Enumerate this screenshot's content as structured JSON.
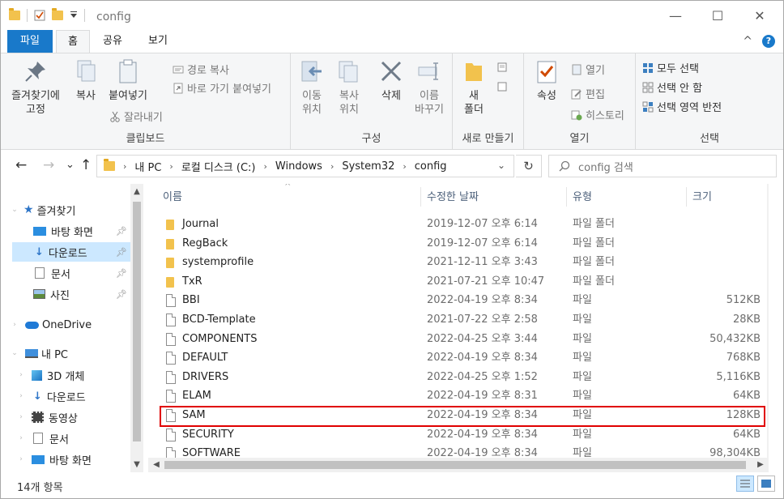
{
  "window": {
    "title": "config",
    "minimize_glyph": "—",
    "maximize_glyph": "☐",
    "close_glyph": "✕"
  },
  "menu": {
    "file": "파일",
    "home": "홈",
    "share": "공유",
    "view": "보기",
    "collapse_glyph": "^",
    "help_glyph": "?"
  },
  "ribbon": {
    "clipboard": {
      "label": "클립보드",
      "pin": "즐겨찾기에\n고정",
      "copy": "복사",
      "paste": "붙여넣기",
      "copy_path": "경로 복사",
      "paste_shortcut": "바로 가기 붙여넣기",
      "cut": "잘라내기"
    },
    "organize": {
      "label": "구성",
      "move_to": "이동\n위치",
      "copy_to": "복사\n위치",
      "delete": "삭제",
      "rename": "이름\n바꾸기"
    },
    "new": {
      "label": "새로 만들기",
      "new_folder": "새\n폴더"
    },
    "open": {
      "label": "열기",
      "properties": "속성",
      "open": "열기",
      "edit": "편집",
      "history": "히스토리"
    },
    "select": {
      "label": "선택",
      "select_all": "모두 선택",
      "select_none": "선택 안 함",
      "invert": "선택 영역 반전"
    }
  },
  "address": {
    "back_glyph": "←",
    "forward_glyph": "→",
    "recent_glyph": "⌄",
    "up_glyph": "↑",
    "crumbs": [
      "내 PC",
      "로컬 디스크 (C:)",
      "Windows",
      "System32",
      "config"
    ],
    "refresh_glyph": "↻",
    "search_placeholder": "config 검색"
  },
  "sidebar": {
    "items": [
      {
        "label": "즐겨찾기",
        "icon": "star-icon"
      },
      {
        "label": "바탕 화면",
        "icon": "desktop-icon"
      },
      {
        "label": "다운로드",
        "icon": "download-icon"
      },
      {
        "label": "문서",
        "icon": "document-icon"
      },
      {
        "label": "사진",
        "icon": "picture-icon"
      },
      {
        "label": "OneDrive",
        "icon": "cloud-icon"
      },
      {
        "label": "내 PC",
        "icon": "computer-icon"
      },
      {
        "label": "3D 개체",
        "icon": "cube-icon"
      },
      {
        "label": "다운로드",
        "icon": "download-icon"
      },
      {
        "label": "동영상",
        "icon": "video-icon"
      },
      {
        "label": "문서",
        "icon": "document-icon"
      },
      {
        "label": "바탕 화면",
        "icon": "desktop-icon"
      }
    ]
  },
  "columns": {
    "name": "이름",
    "date": "수정한 날짜",
    "type": "유형",
    "size": "크기"
  },
  "files": [
    {
      "name": "Journal",
      "date": "2019-12-07 오후 6:14",
      "type": "파일 폴더",
      "size": "",
      "kind": "folder"
    },
    {
      "name": "RegBack",
      "date": "2019-12-07 오후 6:14",
      "type": "파일 폴더",
      "size": "",
      "kind": "folder"
    },
    {
      "name": "systemprofile",
      "date": "2021-12-11 오후 3:43",
      "type": "파일 폴더",
      "size": "",
      "kind": "folder"
    },
    {
      "name": "TxR",
      "date": "2021-07-21 오후 10:47",
      "type": "파일 폴더",
      "size": "",
      "kind": "folder"
    },
    {
      "name": "BBI",
      "date": "2022-04-19 오후 8:34",
      "type": "파일",
      "size": "512KB",
      "kind": "file"
    },
    {
      "name": "BCD-Template",
      "date": "2021-07-22 오후 2:58",
      "type": "파일",
      "size": "28KB",
      "kind": "file"
    },
    {
      "name": "COMPONENTS",
      "date": "2022-04-25 오후 3:44",
      "type": "파일",
      "size": "50,432KB",
      "kind": "file"
    },
    {
      "name": "DEFAULT",
      "date": "2022-04-19 오후 8:34",
      "type": "파일",
      "size": "768KB",
      "kind": "file"
    },
    {
      "name": "DRIVERS",
      "date": "2022-04-25 오후 1:52",
      "type": "파일",
      "size": "5,116KB",
      "kind": "file"
    },
    {
      "name": "ELAM",
      "date": "2022-04-19 오후 8:31",
      "type": "파일",
      "size": "64KB",
      "kind": "file"
    },
    {
      "name": "SAM",
      "date": "2022-04-19 오후 8:34",
      "type": "파일",
      "size": "128KB",
      "kind": "file"
    },
    {
      "name": "SECURITY",
      "date": "2022-04-19 오후 8:34",
      "type": "파일",
      "size": "64KB",
      "kind": "file"
    },
    {
      "name": "SOFTWARE",
      "date": "2022-04-19 오후 8:34",
      "type": "파일",
      "size": "98,304KB",
      "kind": "file"
    }
  ],
  "status": {
    "item_count": "14개 항목"
  },
  "colors": {
    "accent": "#1979ca",
    "highlight": "#e00000",
    "selection": "#cce8ff"
  }
}
